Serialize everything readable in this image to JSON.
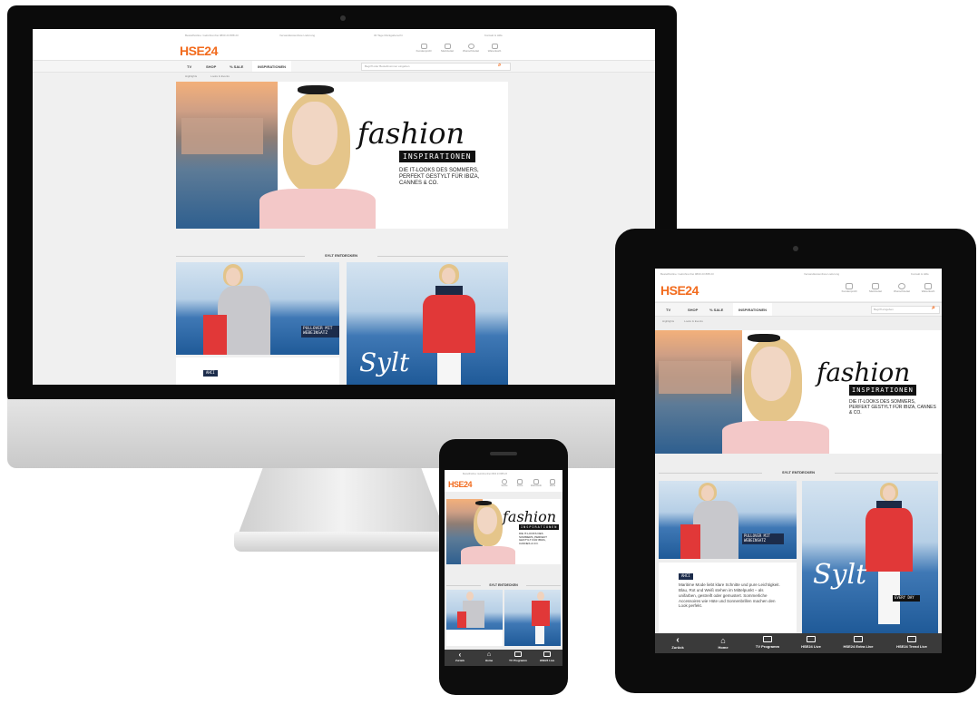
{
  "brand": {
    "logo": "HSE24",
    "accent": "#f26b1d"
  },
  "desktop": {
    "topbar": {
      "hotline": "Bestellhotline: Gebührenfrei 0800 23 888 23",
      "delivery": "Versandkostenfreie Lieferung",
      "returns": "30 Tage Rückgaberecht",
      "contact": "Kontakt & Hilfe"
    },
    "utils": [
      "Kundenprofil",
      "Merkzettel",
      "Wunschzettel",
      "Warenkorb"
    ],
    "nav": [
      "TV",
      "SHOP",
      "% SALE",
      "INSPIRATIONEN"
    ],
    "search_placeholder": "Begriff oder Bestellnummer eingeben",
    "subnav": [
      "Highlights",
      "Looks & Events"
    ],
    "hero": {
      "script": "fashion",
      "tag": "INSPIRATIONEN",
      "desc": "DIE IT-LOOKS DES SOMMERS, PERFEKT GESTYLT FÜR IBIZA, CANNES & CO."
    },
    "section_title": "SYLT ENTDECKEN",
    "card1_label": "PULLOVER MIT WEBEINSATZ",
    "card2_script": "Sylt",
    "badge": "AHCI"
  },
  "tablet": {
    "topbar": {
      "hotline": "Bestellhotline: Gebührenfrei 0800 23 888 23",
      "delivery": "Versandkostenfreie Lieferung",
      "contact": "Kontakt & Hilfe"
    },
    "utils": [
      "Kundenprofil",
      "Merkzettel",
      "Wunschzettel",
      "Warenkorb"
    ],
    "nav": [
      "TV",
      "SHOP",
      "% SALE",
      "INSPIRATIONEN"
    ],
    "search_placeholder": "Begriff eingeben",
    "subnav": [
      "Highlights",
      "Looks & Events"
    ],
    "hero": {
      "script": "fashion",
      "tag": "INSPIRATIONEN",
      "desc": "DIE IT-LOOKS DES SOMMERS, PERFEKT GESTYLT FÜR IBIZA, CANNES & CO."
    },
    "section_title": "SYLT ENTDECKEN",
    "card1_label": "PULLOVER MIT WEBEINSATZ",
    "card2_script": "Sylt",
    "card2_label": "EVERY DAY",
    "badge": "AHCI",
    "body": "Maritime Mode liebt klare Schnitte und pure Leichtigkeit. Blau, Rot und Weiß stehen im Mittelpunkt – als unifarben, gestreift oder gemustert. Sommerliche Accessoires wie Hüte und Sonnenbrillen machen den Look perfekt.",
    "bottom_nav": [
      "Zurück",
      "Home",
      "TV Programm",
      "HSE24 Live",
      "HSE24 Extra Live",
      "HSE24 Trend Live"
    ]
  },
  "phone": {
    "topbar": "Bestellhotline: Gebührenfrei 0800 23 888 23",
    "utils": [
      "Suche",
      "Konto",
      "Warenkorb",
      "Menü"
    ],
    "hero": {
      "script": "fashion",
      "tag": "INSPIRATIONEN",
      "desc": "DIE IT-LOOKS DES SOMMERS, PERFEKT GESTYLT FÜR IBIZA, CANNES & CO."
    },
    "section_title": "SYLT ENTDECKEN",
    "bottom_nav": [
      "Zurück",
      "Home",
      "TV Programm",
      "HSE24 Live"
    ]
  }
}
